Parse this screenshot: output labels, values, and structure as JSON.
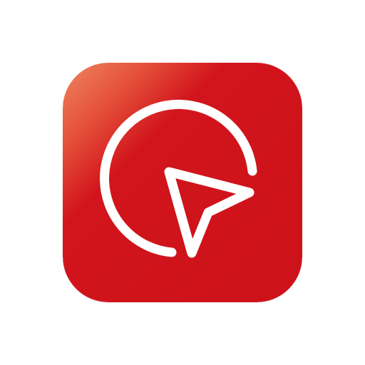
{
  "icon": {
    "name": "navigation-pointer-app-icon",
    "symbol": "cursor-arrow-in-open-circle-icon",
    "colors": {
      "background_primary": "#D2151C",
      "background_highlight": "#EC7A55",
      "glyph": "#FFFFFF",
      "page_background": "#FFFFFF"
    }
  }
}
